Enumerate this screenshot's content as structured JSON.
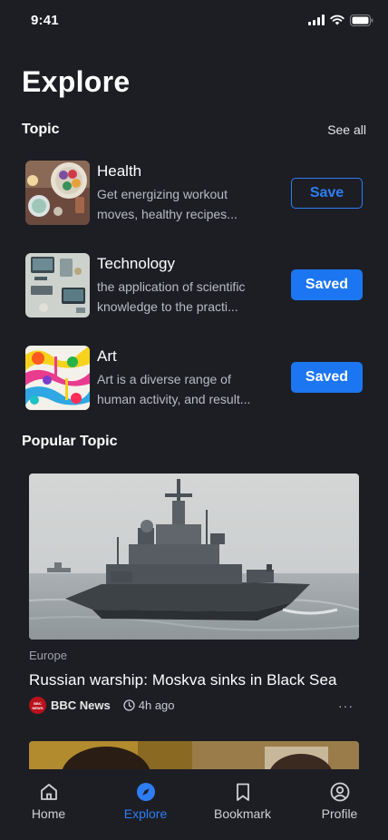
{
  "status_bar": {
    "time": "9:41"
  },
  "page": {
    "title": "Explore"
  },
  "topic_section": {
    "title": "Topic",
    "see_all": "See all",
    "items": [
      {
        "name": "Health",
        "desc_line1": "Get energizing workout",
        "desc_line2": "moves, healthy recipes...",
        "button": "Save",
        "saved": false
      },
      {
        "name": "Technology",
        "desc_line1": "the application of scientific",
        "desc_line2": "knowledge to the practi...",
        "button": "Saved",
        "saved": true
      },
      {
        "name": "Art",
        "desc_line1": "Art is a diverse range of",
        "desc_line2": "human activity, and result...",
        "button": "Saved",
        "saved": true
      }
    ]
  },
  "popular_section": {
    "title": "Popular Topic"
  },
  "news": [
    {
      "category": "Europe",
      "title": "Russian warship: Moskva sinks in Black Sea",
      "source": "BBC News",
      "source_logo_text": "BBC NEWS",
      "time": "4h ago",
      "more": "···"
    }
  ],
  "bottom_nav": {
    "active": "Explore",
    "items": [
      {
        "label": "Home",
        "icon": "home-icon"
      },
      {
        "label": "Explore",
        "icon": "compass-icon"
      },
      {
        "label": "Bookmark",
        "icon": "bookmark-icon"
      },
      {
        "label": "Profile",
        "icon": "profile-icon"
      }
    ]
  },
  "colors": {
    "background": "#1c1e24",
    "accent": "#1c76f2",
    "text_secondary": "#b9bcc3",
    "news_source": "#b8121b"
  }
}
